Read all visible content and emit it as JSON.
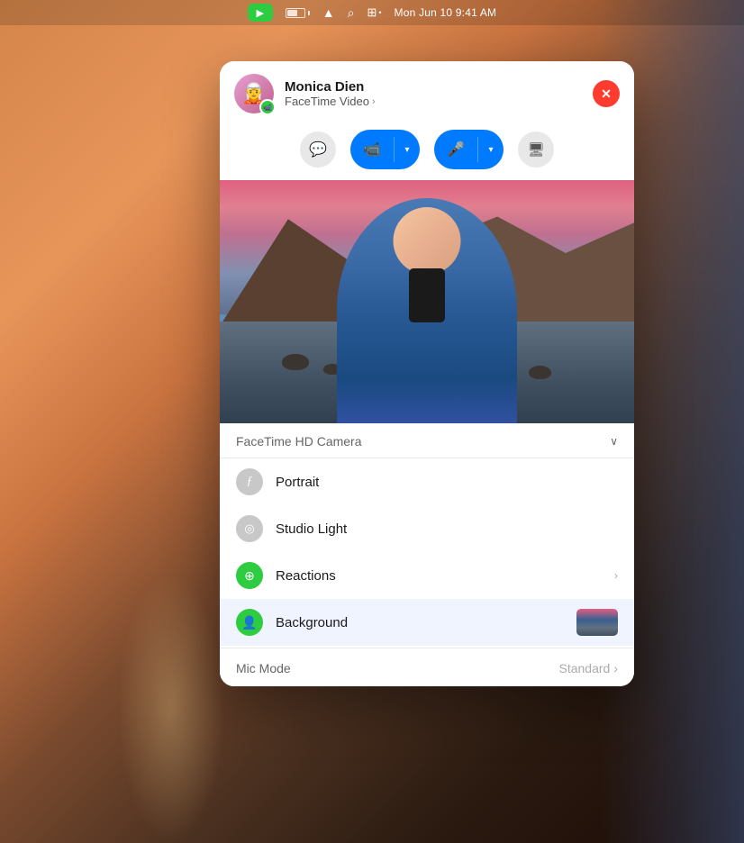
{
  "desktop": {
    "bg_description": "macOS warm sunset gradient background"
  },
  "menubar": {
    "facetime_icon": "▶",
    "battery_level": "60%",
    "wifi_label": "WiFi",
    "search_label": "Search",
    "control_center_label": "Control Center",
    "datetime": "Mon Jun 10  9:41 AM"
  },
  "facetime_panel": {
    "contact_name": "Monica Dien",
    "call_type": "FaceTime Video",
    "call_type_chevron": "›",
    "close_button_label": "✕",
    "avatar_emoji": "🧝",
    "avatar_badge": "📹",
    "controls": {
      "chat_icon": "💬",
      "video_icon": "📹",
      "mic_icon": "🎤",
      "screen_icon": "🖥",
      "dropdown_arrow": "▾"
    },
    "camera_section": {
      "label": "FaceTime HD Camera",
      "chevron": "∨"
    },
    "menu_items": [
      {
        "id": "portrait",
        "label": "Portrait",
        "icon_style": "gray",
        "icon": "ƒ",
        "has_arrow": false,
        "has_thumbnail": false
      },
      {
        "id": "studio-light",
        "label": "Studio Light",
        "icon_style": "gray",
        "icon": "◎",
        "has_arrow": false,
        "has_thumbnail": false
      },
      {
        "id": "reactions",
        "label": "Reactions",
        "icon_style": "green",
        "icon": "⊕",
        "has_arrow": true,
        "has_thumbnail": false
      },
      {
        "id": "background",
        "label": "Background",
        "icon_style": "green",
        "icon": "👤",
        "has_arrow": false,
        "has_thumbnail": true,
        "active": true
      }
    ],
    "mic_mode": {
      "label": "Mic Mode",
      "value": "Standard",
      "arrow": "›"
    }
  }
}
